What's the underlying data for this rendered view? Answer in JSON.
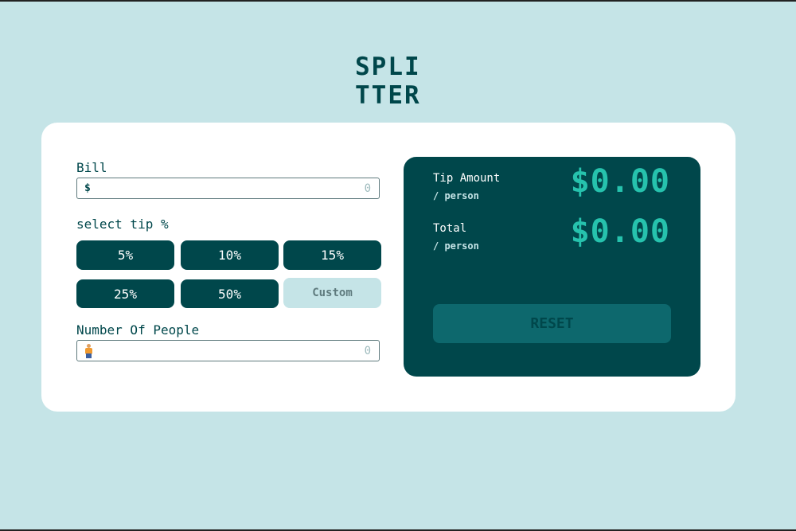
{
  "logo": {
    "line1": "SPLI",
    "line2": "TTER"
  },
  "bill": {
    "label": "Bill",
    "prefix": "$",
    "placeholder": "0"
  },
  "tip": {
    "label": "select tip %",
    "options": [
      "5%",
      "10%",
      "15%",
      "25%",
      "50%"
    ],
    "custom_label": "Custom"
  },
  "people": {
    "label": "Number Of People",
    "placeholder": "0",
    "icon": "person-icon"
  },
  "result": {
    "tip_amount_label": "Tip Amount",
    "tip_amount_sub": "/ person",
    "tip_amount_value": "$0.00",
    "total_label": "Total",
    "total_sub": "/ person",
    "total_value": "$0.00",
    "reset_label": "RESET"
  },
  "colors": {
    "background": "#c5e4e7",
    "dark_teal": "#00474b",
    "accent": "#26c2ad",
    "reset_bg": "#0d686d",
    "card": "#ffffff"
  }
}
